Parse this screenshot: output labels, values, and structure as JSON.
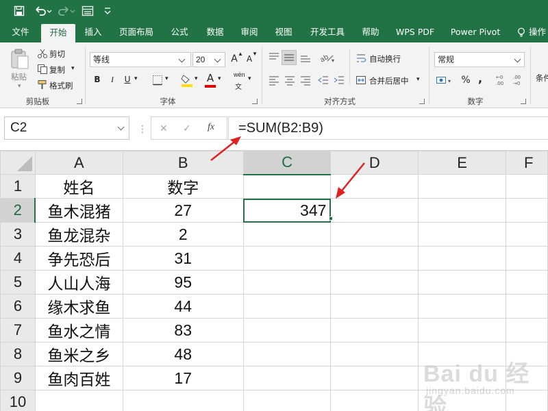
{
  "quick_access": {
    "save_icon": "save-icon",
    "undo_icon": "undo-icon",
    "redo_icon": "redo-icon",
    "form_icon": "form-icon",
    "customize_icon": "customize-icon"
  },
  "tabs": [
    {
      "label": "文件"
    },
    {
      "label": "开始"
    },
    {
      "label": "插入"
    },
    {
      "label": "页面布局"
    },
    {
      "label": "公式"
    },
    {
      "label": "数据"
    },
    {
      "label": "审阅"
    },
    {
      "label": "视图"
    },
    {
      "label": "开发工具"
    },
    {
      "label": "帮助"
    },
    {
      "label": "WPS PDF"
    },
    {
      "label": "Power Pivot"
    },
    {
      "label": "操作"
    }
  ],
  "ribbon": {
    "clipboard": {
      "paste": "粘贴",
      "cut": "剪切",
      "copy": "复制",
      "format_painter": "格式刷",
      "group": "剪贴板"
    },
    "font": {
      "font_name": "等线",
      "font_size": "20",
      "grow": "A",
      "shrink": "A",
      "bold": "B",
      "italic": "I",
      "underline": "U",
      "font_color": "A",
      "phonetic": "wén",
      "group": "字体"
    },
    "alignment": {
      "wrap_text": "自动换行",
      "merge_center": "合并后居中",
      "group": "对齐方式"
    },
    "number": {
      "format": "常规",
      "percent": "%",
      "comma": ",",
      "group": "数字"
    },
    "styles": {
      "conditional": "条件"
    }
  },
  "formula_bar": {
    "name_box": "C2",
    "cancel": "✕",
    "enter": "✓",
    "fx": "fx",
    "formula": "=SUM(B2:B9)"
  },
  "grid": {
    "columns": [
      "A",
      "B",
      "C",
      "D",
      "E",
      "F"
    ],
    "rows": [
      {
        "num": "1",
        "a": "姓名",
        "b": "数字",
        "c": ""
      },
      {
        "num": "2",
        "a": "鱼木混猪",
        "b": "27",
        "c": "347"
      },
      {
        "num": "3",
        "a": "鱼龙混杂",
        "b": "2",
        "c": ""
      },
      {
        "num": "4",
        "a": "争先恐后",
        "b": "31",
        "c": ""
      },
      {
        "num": "5",
        "a": "人山人海",
        "b": "95",
        "c": ""
      },
      {
        "num": "6",
        "a": "缘木求鱼",
        "b": "44",
        "c": ""
      },
      {
        "num": "7",
        "a": "鱼水之情",
        "b": "83",
        "c": ""
      },
      {
        "num": "8",
        "a": "鱼米之乡",
        "b": "48",
        "c": ""
      },
      {
        "num": "9",
        "a": "鱼肉百姓",
        "b": "17",
        "c": ""
      },
      {
        "num": "10",
        "a": "",
        "b": "",
        "c": ""
      }
    ]
  },
  "watermark": {
    "text": "Bai du 经验",
    "sub": "jingyan.baidu.com"
  },
  "colors": {
    "excel_green": "#217346",
    "annotation_red": "#e02020"
  }
}
